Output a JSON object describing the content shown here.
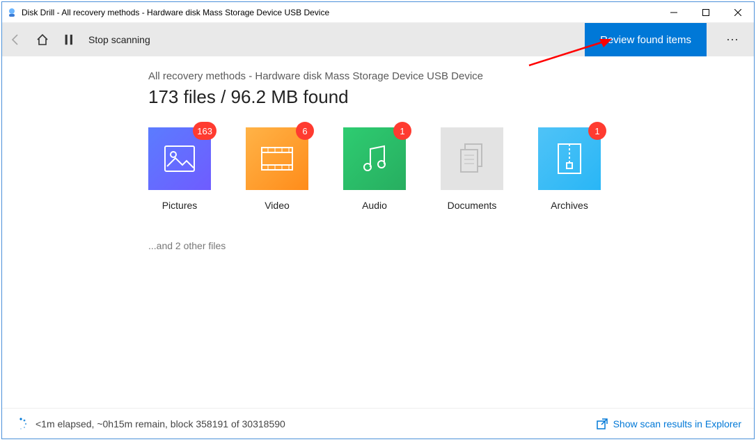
{
  "window": {
    "title": "Disk Drill - All recovery methods - Hardware disk Mass Storage Device USB Device"
  },
  "toolbar": {
    "stop_label": "Stop scanning",
    "review_label": "Review found items"
  },
  "main": {
    "subtitle": "All recovery methods - Hardware disk Mass Storage Device USB Device",
    "headline": "173 files / 96.2 MB found",
    "other_files": "...and 2 other files"
  },
  "cards": [
    {
      "label": "Pictures",
      "badge": "163"
    },
    {
      "label": "Video",
      "badge": "6"
    },
    {
      "label": "Audio",
      "badge": "1"
    },
    {
      "label": "Documents",
      "badge": null
    },
    {
      "label": "Archives",
      "badge": "1"
    }
  ],
  "status": {
    "text": "<1m elapsed, ~0h15m remain, block 358191 of 30318590",
    "explorer_link": "Show scan results in Explorer"
  }
}
